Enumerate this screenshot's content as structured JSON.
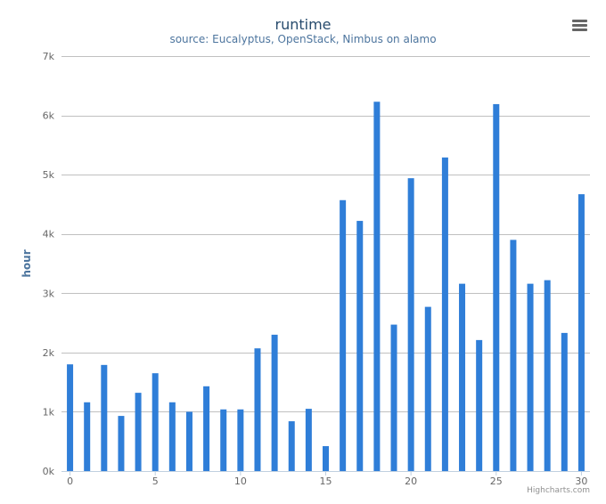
{
  "chart_data": {
    "type": "bar",
    "title": "runtime",
    "subtitle": "source: Eucalyptus, OpenStack, Nimbus on alamo",
    "ylabel": "hour",
    "xlabel": "",
    "ylim": [
      0,
      7000
    ],
    "y_ticks": [
      "0k",
      "1k",
      "2k",
      "3k",
      "4k",
      "5k",
      "6k",
      "7k"
    ],
    "y_tick_values": [
      0,
      1000,
      2000,
      3000,
      4000,
      5000,
      6000,
      7000
    ],
    "x_ticks": [
      "0",
      "5",
      "10",
      "15",
      "20",
      "25",
      "30"
    ],
    "x_tick_values": [
      0,
      5,
      10,
      15,
      20,
      25,
      30
    ],
    "x": [
      0,
      1,
      2,
      3,
      4,
      5,
      6,
      7,
      8,
      9,
      10,
      11,
      12,
      13,
      14,
      15,
      16,
      17,
      18,
      19,
      20,
      21,
      22,
      23,
      24,
      25,
      26,
      27,
      28,
      29,
      30
    ],
    "values": [
      1800,
      1160,
      1790,
      930,
      1320,
      1650,
      1160,
      1000,
      1430,
      1040,
      1040,
      2070,
      2300,
      840,
      1050,
      420,
      4570,
      4220,
      6230,
      2470,
      4940,
      2770,
      5290,
      3160,
      2210,
      6190,
      3900,
      3160,
      3220,
      2330,
      4670
    ],
    "color": "#2f7ed8",
    "grid": true,
    "legend": false
  },
  "credits": "Highcharts.com",
  "menu_icon": "hamburger-menu-icon"
}
